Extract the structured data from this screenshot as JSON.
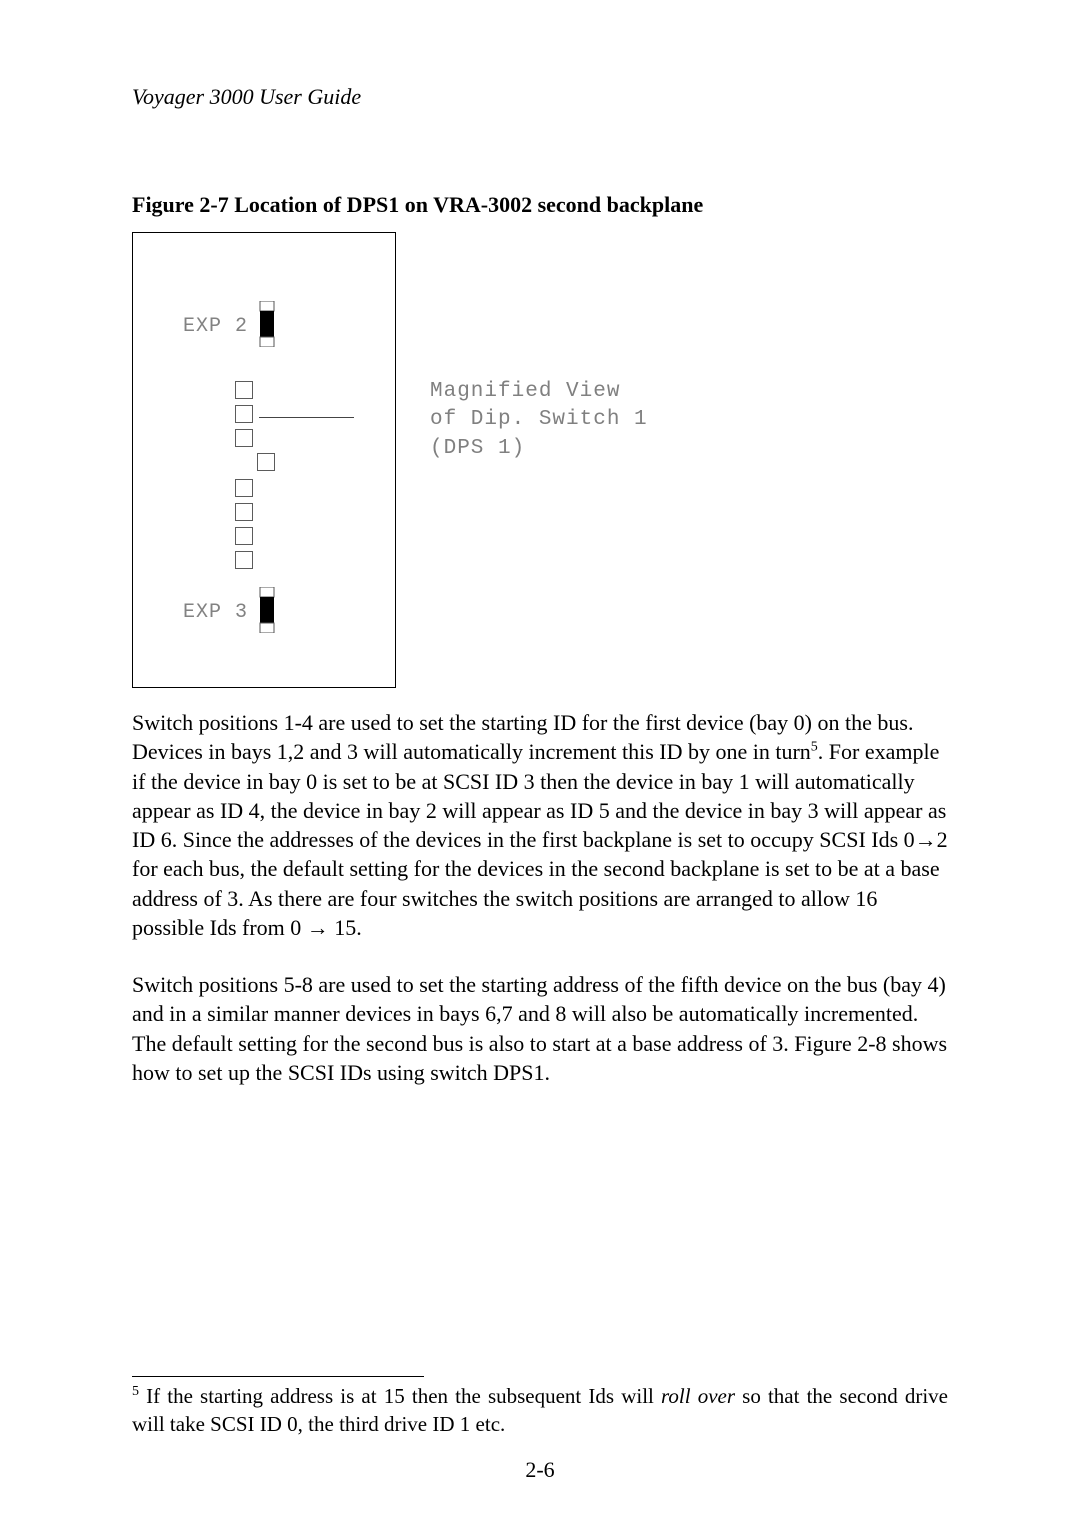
{
  "header": {
    "title": "Voyager 3000 User Guide"
  },
  "figure": {
    "caption": "Figure 2-7 Location of DPS1 on VRA-3002 second backplane",
    "exp_top": "EXP 2",
    "exp_bottom": "EXP 3",
    "annotation_l1": "Magnified View",
    "annotation_l2": "of Dip. Switch 1",
    "annotation_l3": "(DPS 1)"
  },
  "body": {
    "p1_a": "Switch positions 1-4 are used to set the starting ID for the first device (bay 0) on the bus. Devices in bays 1,2 and 3 will automatically increment this ID by one in turn",
    "p1_sup": "5",
    "p1_b": ".  For example if the device in bay 0 is set to be at SCSI ID 3 then the device in bay 1 will automatically appear as ID 4, the device in bay 2 will appear as ID 5 and the device in bay 3 will appear as ID 6. Since the addresses of the devices in the first backplane is set to occupy SCSI Ids 0",
    "p1_arrow1": "→",
    "p1_c": "2 for each bus, the default setting for the devices in the second backplane is set to be at a base address of 3. As there are four switches the switch positions are arranged to allow 16 possible Ids from 0 ",
    "p1_arrow2": "→",
    "p1_d": " 15.",
    "p2": "Switch positions 5-8 are used to set the starting address of the fifth device on the bus (bay 4) and in a similar manner devices in bays 6,7 and 8 will also be automatically incremented. The default setting for the second bus is also to start at a base address of 3. Figure 2-8 shows how to set up the SCSI IDs using switch DPS1."
  },
  "footnote": {
    "num": "5",
    "a": " If the starting address is at 15 then the subsequent Ids will ",
    "italic": "roll over",
    "b": " so that the second drive will take SCSI ID 0, the third drive ID 1 etc."
  },
  "page_number": "2-6"
}
